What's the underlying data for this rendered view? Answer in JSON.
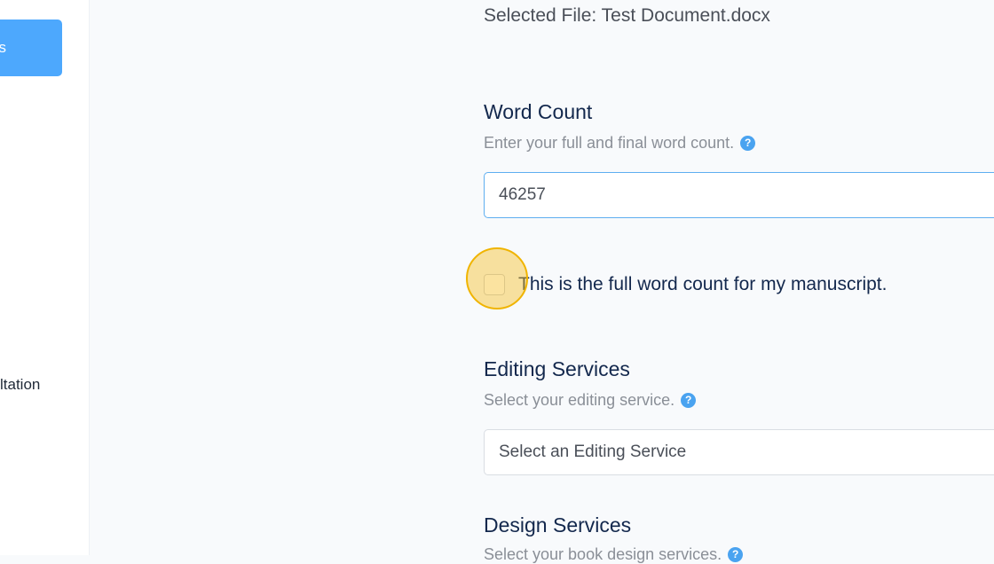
{
  "sidebar": {
    "active_item_label": "s",
    "item_2_label": "ltation"
  },
  "main": {
    "selected_file_text": "Selected File: Test Document.docx",
    "word_count": {
      "title": "Word Count",
      "helper": "Enter your full and final word count.",
      "value": "46257",
      "checkbox_label": "This is the full word count for my manuscript.",
      "checkbox_checked": false
    },
    "editing_services": {
      "title": "Editing Services",
      "helper": "Select your editing service.",
      "select_value": "Select an Editing Service"
    },
    "design_services": {
      "title": "Design Services",
      "helper": "Select your book design services."
    }
  },
  "icons": {
    "help": "question-circle-icon",
    "help_glyph": "?"
  },
  "colors": {
    "accent": "#4da8fd",
    "heading": "#13284d",
    "click_highlight": "#f0b400"
  }
}
